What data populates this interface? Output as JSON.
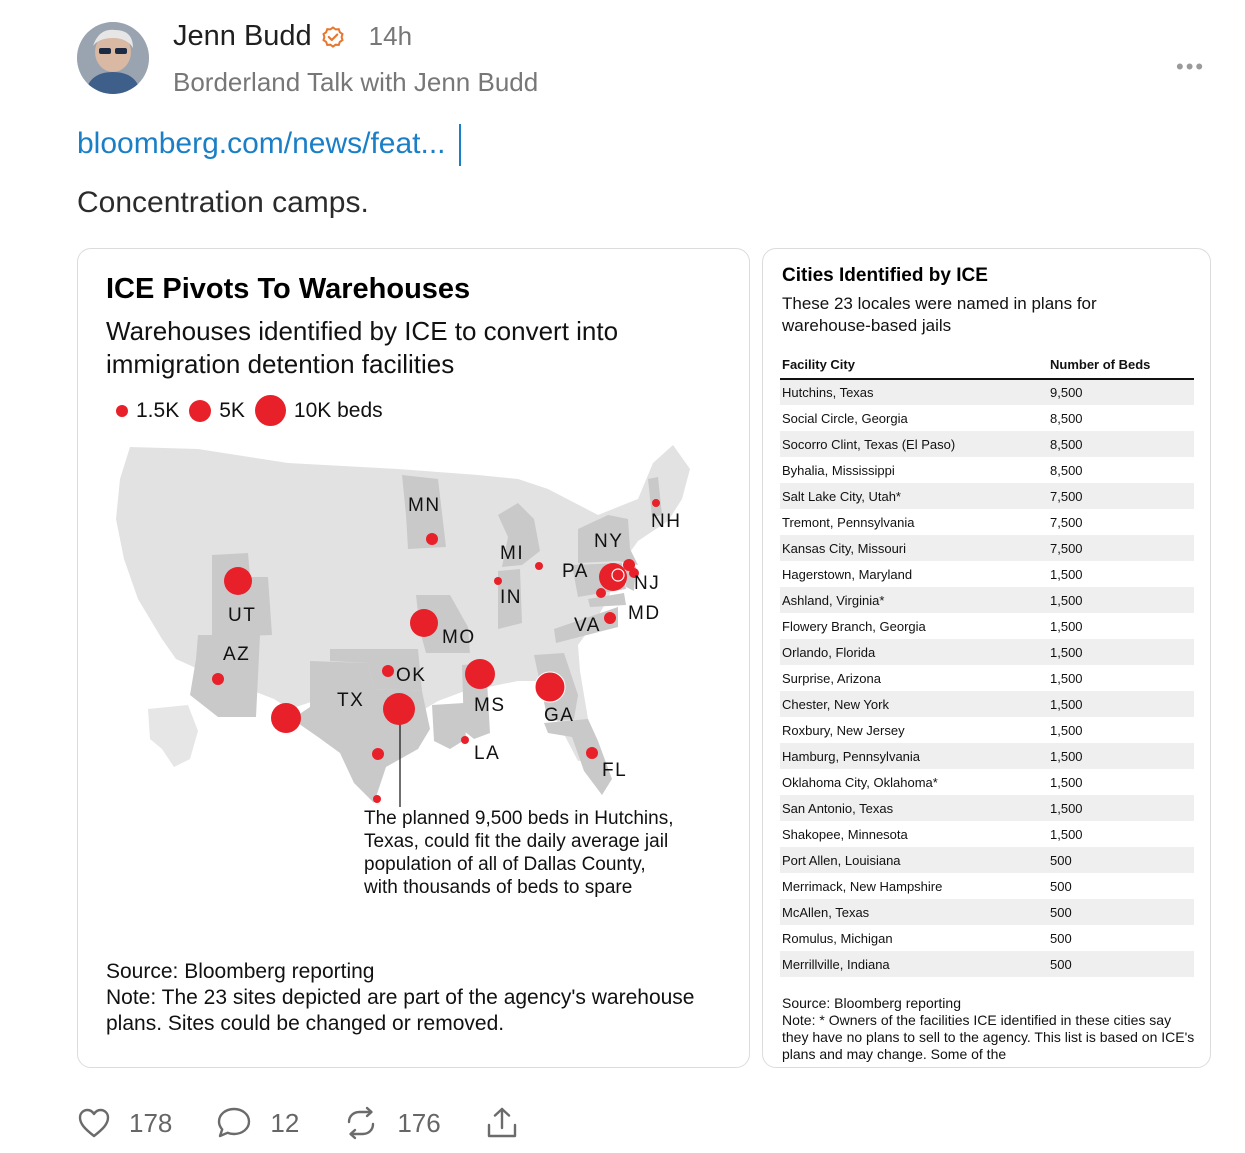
{
  "post": {
    "author": "Jenn Budd",
    "time": "14h",
    "publication": "Borderland Talk with Jenn Budd",
    "more_label": "•••",
    "link_text": "bloomberg.com/news/feat...",
    "body": "Concentration camps."
  },
  "map_card": {
    "title": "ICE Pivots To Warehouses",
    "subtitle": "Warehouses identified by ICE to convert into immigration detention facilities",
    "legend": [
      "1.5K",
      "5K",
      "10K beds"
    ],
    "state_labels": [
      "MN",
      "NH",
      "NY",
      "MI",
      "PA",
      "NJ",
      "IN",
      "MD",
      "UT",
      "VA",
      "MO",
      "AZ",
      "OK",
      "TX",
      "MS",
      "GA",
      "LA",
      "FL"
    ],
    "annotation": "The planned 9,500 beds in Hutchins, Texas, could fit the daily average jail population of all of Dallas County, with thousands of beds to spare",
    "source": "Source: Bloomberg reporting",
    "note": "Note: The 23 sites depicted are part of the agency's warehouse plans. Sites could be changed or removed."
  },
  "table_card": {
    "title": "Cities Identified by ICE",
    "subtitle": "These 23 locales were named in plans for warehouse-based jails",
    "col_city": "Facility City",
    "col_beds": "Number of Beds",
    "rows": [
      {
        "city": "Hutchins, Texas",
        "beds": "9,500"
      },
      {
        "city": "Social Circle, Georgia",
        "beds": "8,500"
      },
      {
        "city": "Socorro Clint, Texas (El Paso)",
        "beds": "8,500"
      },
      {
        "city": "Byhalia, Mississippi",
        "beds": "8,500"
      },
      {
        "city": "Salt Lake City, Utah*",
        "beds": "7,500"
      },
      {
        "city": "Tremont, Pennsylvania",
        "beds": "7,500"
      },
      {
        "city": "Kansas City, Missouri",
        "beds": "7,500"
      },
      {
        "city": "Hagerstown, Maryland",
        "beds": "1,500"
      },
      {
        "city": "Ashland, Virginia*",
        "beds": "1,500"
      },
      {
        "city": "Flowery Branch, Georgia",
        "beds": "1,500"
      },
      {
        "city": "Orlando, Florida",
        "beds": "1,500"
      },
      {
        "city": "Surprise, Arizona",
        "beds": "1,500"
      },
      {
        "city": "Chester, New York",
        "beds": "1,500"
      },
      {
        "city": "Roxbury, New Jersey",
        "beds": "1,500"
      },
      {
        "city": "Hamburg, Pennsylvania",
        "beds": "1,500"
      },
      {
        "city": "Oklahoma City, Oklahoma*",
        "beds": "1,500"
      },
      {
        "city": "San Antonio, Texas",
        "beds": "1,500"
      },
      {
        "city": "Shakopee, Minnesota",
        "beds": "1,500"
      },
      {
        "city": "Port Allen, Louisiana",
        "beds": "500"
      },
      {
        "city": "Merrimack, New Hampshire",
        "beds": "500"
      },
      {
        "city": "McAllen, Texas",
        "beds": "500"
      },
      {
        "city": "Romulus, Michigan",
        "beds": "500"
      },
      {
        "city": "Merrillville, Indiana",
        "beds": "500"
      }
    ],
    "source": "Source: Bloomberg reporting",
    "note": "Note: * Owners of the facilities ICE identified in these cities say they have no plans to sell to the agency. This list is based on ICE's plans and may change. Some of the"
  },
  "actions": {
    "likes": "178",
    "comments": "12",
    "restacks": "176"
  },
  "icons": [
    "verified-icon",
    "more-icon",
    "heart-icon",
    "comment-icon",
    "restack-icon",
    "share-icon"
  ],
  "colors": {
    "accent": "#1a7fc6",
    "marker": "#e8202a",
    "verified": "#e8772e"
  }
}
